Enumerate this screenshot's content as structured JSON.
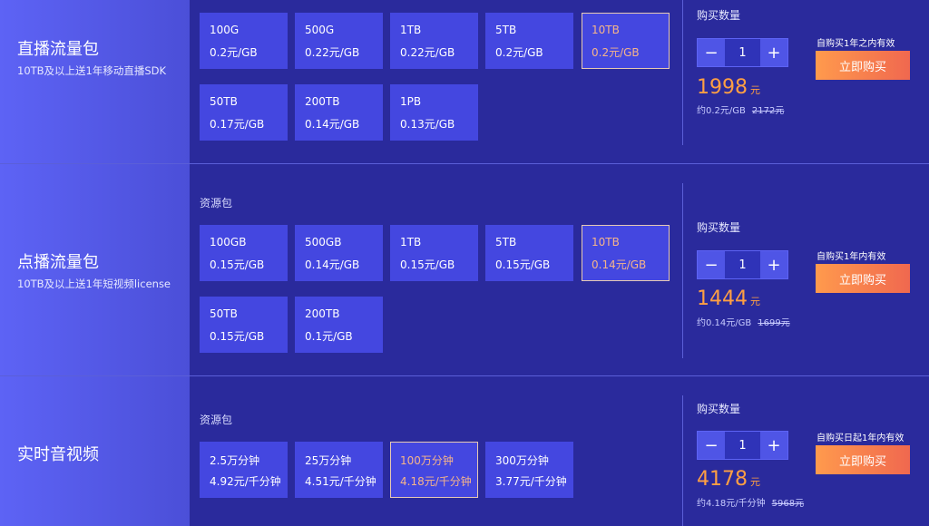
{
  "products": [
    {
      "title": "直播流量包",
      "subtitle": "10TB及以上送1年移动直播SDK",
      "section_label": "",
      "options": [
        {
          "name": "100G",
          "price": "0.2元/GB",
          "selected": false
        },
        {
          "name": "500G",
          "price": "0.22元/GB",
          "selected": false
        },
        {
          "name": "1TB",
          "price": "0.22元/GB",
          "selected": false
        },
        {
          "name": "5TB",
          "price": "0.2元/GB",
          "selected": false
        },
        {
          "name": "10TB",
          "price": "0.2元/GB",
          "selected": true
        },
        {
          "name": "50TB",
          "price": "0.17元/GB",
          "selected": false
        },
        {
          "name": "200TB",
          "price": "0.14元/GB",
          "selected": false
        },
        {
          "name": "1PB",
          "price": "0.13元/GB",
          "selected": false
        }
      ],
      "qty_label": "购买数量",
      "quantity": "1",
      "price": "1998",
      "price_unit": "元",
      "approx": "约0.2元/GB",
      "original_price": "2172元",
      "validity": "自购买1年之内有效",
      "buy_label": "立即购买"
    },
    {
      "title": "点播流量包",
      "subtitle": "10TB及以上送1年短视频license",
      "section_label": "资源包",
      "options": [
        {
          "name": "100GB",
          "price": "0.15元/GB",
          "selected": false
        },
        {
          "name": "500GB",
          "price": "0.14元/GB",
          "selected": false
        },
        {
          "name": "1TB",
          "price": "0.15元/GB",
          "selected": false
        },
        {
          "name": "5TB",
          "price": "0.15元/GB",
          "selected": false
        },
        {
          "name": "10TB",
          "price": "0.14元/GB",
          "selected": true
        },
        {
          "name": "50TB",
          "price": "0.15元/GB",
          "selected": false
        },
        {
          "name": "200TB",
          "price": "0.1元/GB",
          "selected": false
        }
      ],
      "qty_label": "购买数量",
      "quantity": "1",
      "price": "1444",
      "price_unit": "元",
      "approx": "约0.14元/GB",
      "original_price": "1699元",
      "validity": "自购买1年内有效",
      "buy_label": "立即购买"
    },
    {
      "title": "实时音视频",
      "subtitle": "",
      "section_label": "资源包",
      "options": [
        {
          "name": "2.5万分钟",
          "price": "4.92元/千分钟",
          "selected": false
        },
        {
          "name": "25万分钟",
          "price": "4.51元/千分钟",
          "selected": false
        },
        {
          "name": "100万分钟",
          "price": "4.18元/千分钟",
          "selected": true
        },
        {
          "name": "300万分钟",
          "price": "3.77元/千分钟",
          "selected": false
        }
      ],
      "qty_label": "购买数量",
      "quantity": "1",
      "price": "4178",
      "price_unit": "元",
      "approx": "约4.18元/千分钟",
      "original_price": "5968元",
      "validity": "自购买日起1年内有效",
      "buy_label": "立即购买"
    }
  ],
  "icons": {
    "minus": "minus-icon",
    "plus": "plus-icon"
  },
  "colors": {
    "accent_orange": "#ff9f43",
    "selected_border": "#e6c9b3",
    "panel": "#2a2a9c",
    "option": "#4447e0"
  }
}
